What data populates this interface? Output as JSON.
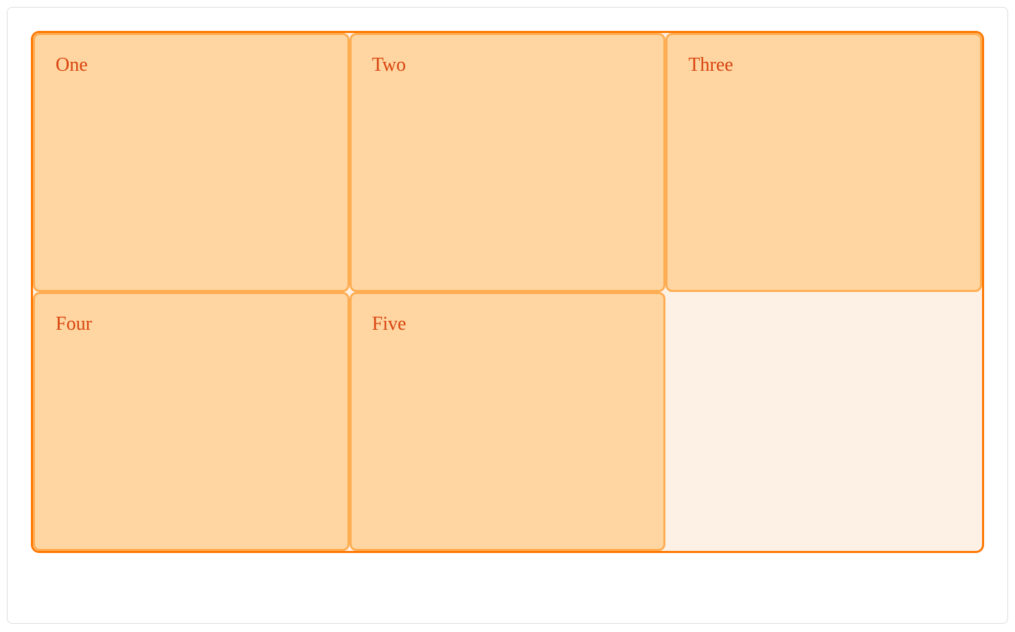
{
  "grid": {
    "cells": [
      {
        "label": "One"
      },
      {
        "label": "Two"
      },
      {
        "label": "Three"
      },
      {
        "label": "Four"
      },
      {
        "label": "Five"
      }
    ]
  },
  "colors": {
    "container_border": "#ff7700",
    "container_bg": "#fdf1e5",
    "cell_bg": "#ffd6a1",
    "cell_border": "#ffad52",
    "text": "#d84410"
  }
}
